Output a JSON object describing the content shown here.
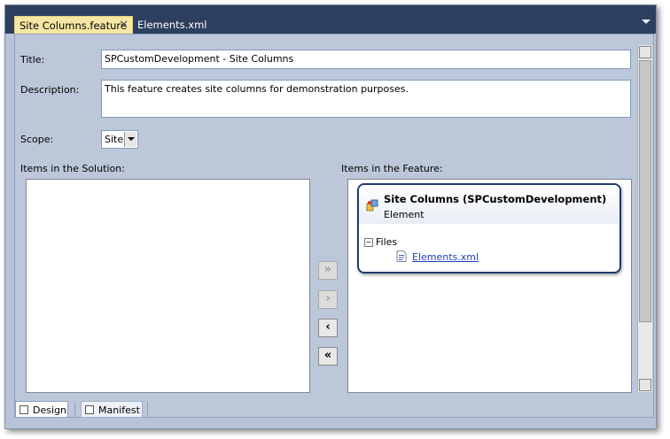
{
  "tabs": {
    "active_label": "Site Columns.feature",
    "inactive_label": "Elements.xml",
    "close_glyph": "✕"
  },
  "form": {
    "title_label": "Title:",
    "title_value": "SPCustomDevelopment  - Site Columns",
    "description_label": "Description:",
    "description_value": "This feature creates site columns for demonstration purposes.",
    "scope_label": "Scope:",
    "scope_value": "Site"
  },
  "lists": {
    "solution_label": "Items in the Solution:",
    "feature_label": "Items in the Feature:"
  },
  "move_buttons": {
    "add_all": "»",
    "add": "›",
    "remove": "‹",
    "remove_all": "«"
  },
  "feature_item": {
    "title": "Site Columns (SPCustomDevelopment)",
    "subtitle": "Element",
    "tree_toggle": "−",
    "files_label": "Files",
    "file_name": "Elements.xml"
  },
  "bottom_tabs": {
    "design": "Design",
    "manifest": "Manifest"
  },
  "colors": {
    "tabstrip_bg": "#2c3f5f",
    "active_tab_bg": "#f6e7a3",
    "editor_bg": "#bcc7d9",
    "card_border": "#1f3a70",
    "link": "#1f3fbf"
  },
  "icons": {
    "close": "close-icon",
    "dropdown": "dropdown-arrow-icon",
    "feature_element": "element-icon",
    "file": "xml-file-icon",
    "design": "design-view-icon",
    "manifest": "manifest-view-icon"
  }
}
